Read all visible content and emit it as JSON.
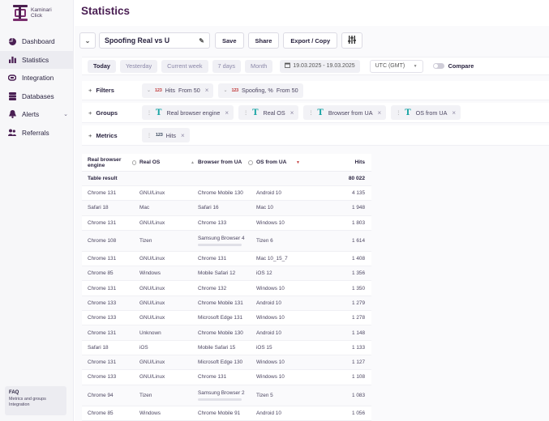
{
  "brand": {
    "line1": "Kaminari",
    "line2": "Click"
  },
  "page_title": "Statistics",
  "sidebar": {
    "items": [
      {
        "label": "Dashboard",
        "icon": "pie-chart-icon"
      },
      {
        "label": "Statistics",
        "icon": "bar-chart-icon"
      },
      {
        "label": "Integration",
        "icon": "link-icon"
      },
      {
        "label": "Databases",
        "icon": "database-icon"
      },
      {
        "label": "Alerts",
        "icon": "bell-icon"
      },
      {
        "label": "Referrals",
        "icon": "people-icon"
      }
    ],
    "active": "Statistics",
    "faq": {
      "title": "FAQ",
      "text": "Metrics and groups Integration"
    }
  },
  "toolbar": {
    "report_name": "Spoofing Real vs U",
    "save": "Save",
    "share": "Share",
    "export": "Export / Copy"
  },
  "datebar": {
    "tabs": [
      "Today",
      "Yesterday",
      "Current week",
      "7 days",
      "Month"
    ],
    "active": "Today",
    "range": "19.03.2025 - 19.03.2025",
    "timezone": "UTC (GMT)",
    "compare": "Compare"
  },
  "filters": {
    "label": "Filters",
    "chips": [
      {
        "icon": "123",
        "name": "Hits",
        "cond": "From 50"
      },
      {
        "icon": "123",
        "name": "Spoofing, %",
        "cond": "From 50"
      }
    ]
  },
  "groups": {
    "label": "Groups",
    "chips": [
      "Real browser engine",
      "Real OS",
      "Browser from UA",
      "OS from UA"
    ]
  },
  "metrics": {
    "label": "Metrics",
    "chips": [
      {
        "icon": "123",
        "name": "Hits"
      }
    ]
  },
  "table": {
    "columns": [
      "Real browser engine",
      "Real OS",
      "Browser from UA",
      "OS from UA",
      "Hits"
    ],
    "total": {
      "label": "Table result",
      "value": "80 022"
    },
    "rows": [
      [
        "Chrome 131",
        "GNU/Linux",
        "Chrome Mobile 130",
        "Android 10",
        "4 135"
      ],
      [
        "Safari 18",
        "Mac",
        "Safari 16",
        "Mac 10",
        "1 948"
      ],
      [
        "Chrome 131",
        "GNU/Linux",
        "Chrome 133",
        "Windows 10",
        "1 803"
      ],
      [
        "Chrome 108",
        "Tizen",
        "Samsung Browser 4",
        "Tizen 6",
        "1 614"
      ],
      [
        "Chrome 131",
        "GNU/Linux",
        "Chrome 131",
        "Mac 10_15_7",
        "1 408"
      ],
      [
        "Chrome 85",
        "Windows",
        "Mobile Safari 12",
        "iOS 12",
        "1 356"
      ],
      [
        "Chrome 131",
        "GNU/Linux",
        "Chrome 132",
        "Windows 10",
        "1 350"
      ],
      [
        "Chrome 133",
        "GNU/Linux",
        "Chrome Mobile 131",
        "Android 10",
        "1 279"
      ],
      [
        "Chrome 133",
        "GNU/Linux",
        "Microsoft Edge 131",
        "Windows 10",
        "1 278"
      ],
      [
        "Chrome 131",
        "Unknown",
        "Chrome Mobile 130",
        "Android 10",
        "1 148"
      ],
      [
        "Safari 18",
        "iOS",
        "Mobile Safari 15",
        "iOS 15",
        "1 133"
      ],
      [
        "Chrome 131",
        "GNU/Linux",
        "Microsoft Edge 130",
        "Windows 10",
        "1 127"
      ],
      [
        "Chrome 133",
        "GNU/Linux",
        "Chrome 131",
        "Windows 10",
        "1 108"
      ],
      [
        "Chrome 94",
        "Tizen",
        "Samsung Browser 2",
        "Tizen 5",
        "1 083"
      ],
      [
        "Chrome 85",
        "Windows",
        "Chrome Mobile 91",
        "Android 10",
        "1 056"
      ]
    ]
  }
}
